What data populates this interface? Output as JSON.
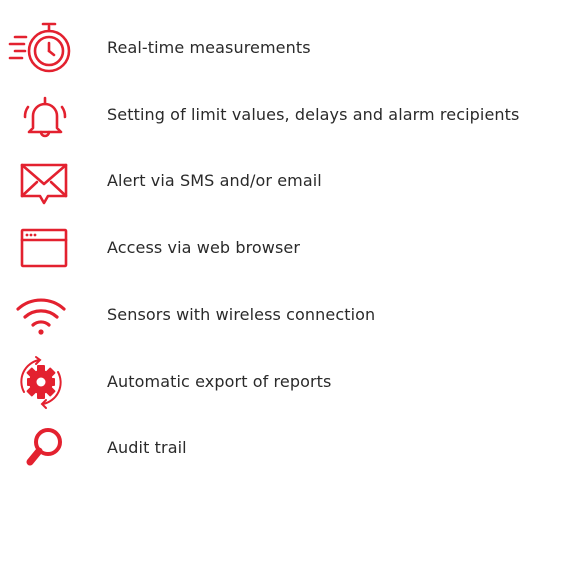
{
  "theme": {
    "accent_color": "#e3212f",
    "text_color": "#2a2a2a"
  },
  "features": [
    {
      "icon": "stopwatch-icon",
      "label": "Real-time measurements"
    },
    {
      "icon": "bell-icon",
      "label": "Setting of limit values, delays and alarm recipients"
    },
    {
      "icon": "envelope-icon",
      "label": "Alert via SMS and/or email"
    },
    {
      "icon": "browser-window-icon",
      "label": "Access via web browser"
    },
    {
      "icon": "wifi-icon",
      "label": "Sensors with wireless connection"
    },
    {
      "icon": "gear-export-icon",
      "label": "Automatic export of reports"
    },
    {
      "icon": "magnifying-glass-icon",
      "label": "Audit trail"
    }
  ]
}
